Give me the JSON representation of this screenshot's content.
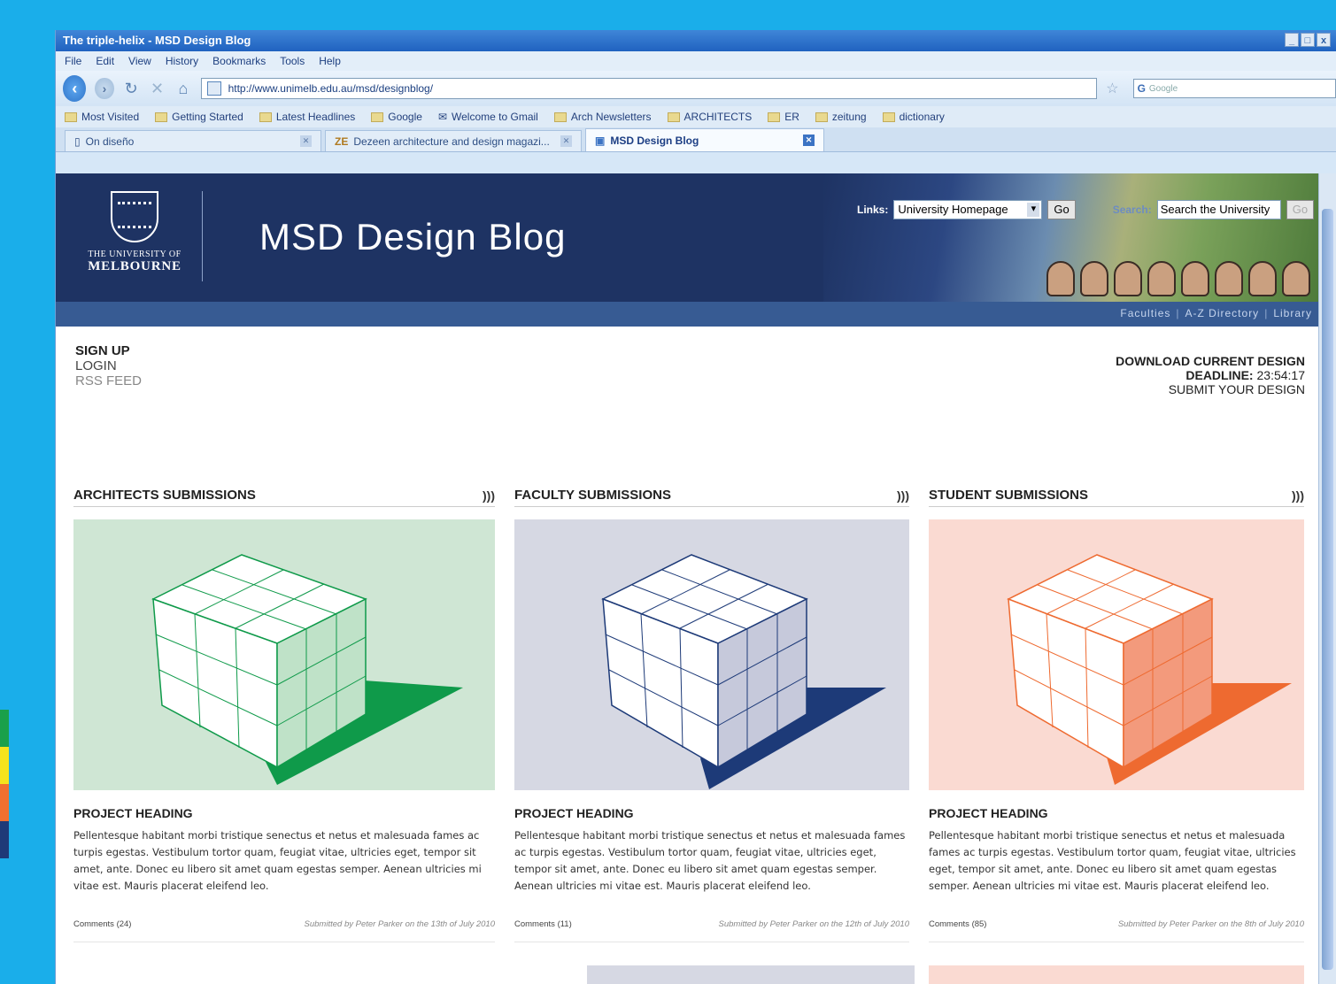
{
  "window": {
    "title": "The triple-helix - MSD Design Blog",
    "controls": [
      "_",
      "□",
      "x"
    ]
  },
  "menu": [
    "File",
    "Edit",
    "View",
    "History",
    "Bookmarks",
    "Tools",
    "Help"
  ],
  "navigation": {
    "url": "http://www.unimelb.edu.au/msd/designblog/",
    "search_placeholder": "Google"
  },
  "bookmarks": [
    "Most Visited",
    "Getting Started",
    "Latest Headlines",
    "Google",
    "Welcome to Gmail",
    "Arch Newsletters",
    "ARCHITECTS",
    "ER",
    "zeitung",
    "dictionary"
  ],
  "tabs": [
    {
      "label": "On diseño"
    },
    {
      "label": "Dezeen architecture and design magazi..."
    },
    {
      "label": "MSD Design Blog"
    }
  ],
  "site": {
    "university_line1": "THE UNIVERSITY OF",
    "university_line2": "MELBOURNE",
    "blog_title": "MSD Design Blog",
    "links_label": "Links:",
    "links_selected": "University Homepage",
    "go_label": "Go",
    "search_label": "Search:",
    "search_value": "Search the University",
    "search_go": "Go",
    "sublinks": [
      "Faculties",
      "A-Z Directory",
      "Library"
    ],
    "sublink_sep": "|"
  },
  "account": {
    "sign_up": "SIGN UP",
    "login": "LOGIN",
    "rss": "RSS FEED"
  },
  "design": {
    "download": "DOWNLOAD CURRENT DESIGN",
    "deadline_label": "DEADLINE:",
    "deadline_value": "23:54:17",
    "submit": "SUBMIT YOUR DESIGN"
  },
  "columns": [
    {
      "heading": "ARCHITECTS SUBMISSIONS",
      "rss_icon": "rss-icon",
      "bg": "#cfe6d4",
      "accent": "#0f9a4a",
      "project_heading": "PROJECT HEADING",
      "body": "Pellentesque habitant morbi tristique senectus et netus et malesuada fames ac turpis egestas. Vestibulum tortor quam, feugiat vitae, ultricies eget, tempor sit amet, ante. Donec eu libero sit amet quam egestas semper. Aenean ultricies mi vitae est. Mauris placerat eleifend leo.",
      "comments": "Comments (24)",
      "submitted": "Submitted by Peter Parker on the 13th of July 2010"
    },
    {
      "heading": "FACULTY SUBMISSIONS",
      "rss_icon": "rss-icon",
      "bg": "#d6d8e3",
      "accent": "#1d3a78",
      "project_heading": "PROJECT HEADING",
      "body": "Pellentesque habitant morbi tristique senectus et netus et malesuada fames ac turpis egestas. Vestibulum tortor quam, feugiat vitae, ultricies eget, tempor sit amet, ante. Donec eu libero sit amet quam egestas semper. Aenean ultricies mi vitae est. Mauris placerat eleifend leo.",
      "comments": "Comments (11)",
      "submitted": "Submitted by Peter Parker on the 12th of July 2010"
    },
    {
      "heading": "STUDENT SUBMISSIONS",
      "rss_icon": "rss-icon",
      "bg": "#fadad2",
      "accent": "#ee6a30",
      "project_heading": "PROJECT HEADING",
      "body": "Pellentesque habitant morbi tristique senectus et netus et malesuada fames ac turpis egestas. Vestibulum tortor quam, feugiat vitae, ultricies eget, tempor sit amet, ante. Donec eu libero sit amet quam egestas semper. Aenean ultricies mi vitae est. Mauris placerat eleifend leo.",
      "comments": "Comments (85)",
      "submitted": "Submitted by Peter Parker on the 8th of July 2010"
    }
  ],
  "colors": {
    "backdrop": "#1aaeea",
    "banner": "#1e3363",
    "subbar": "#375b93"
  }
}
